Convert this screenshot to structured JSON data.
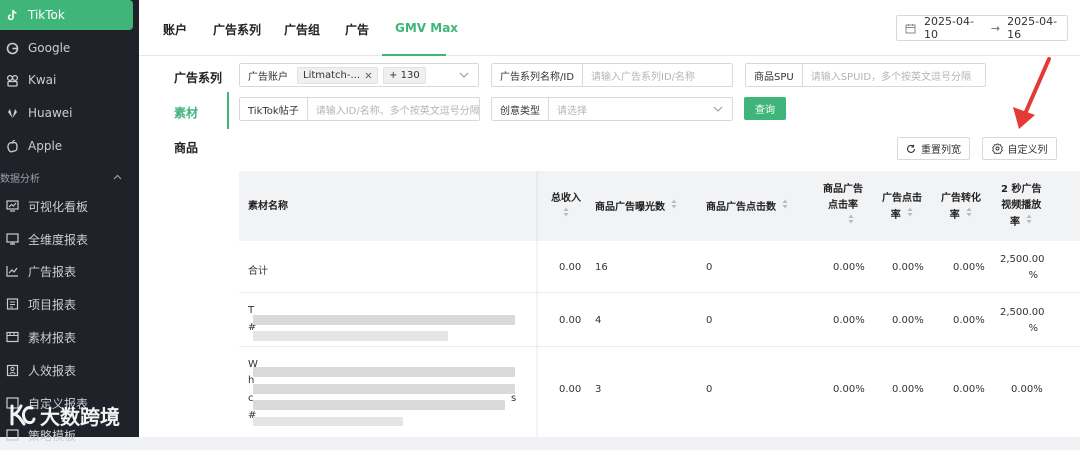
{
  "sidebar": {
    "items": [
      {
        "label": "TikTok",
        "icon": "tiktok-icon",
        "active": true
      },
      {
        "label": "Google",
        "icon": "google-icon"
      },
      {
        "label": "Kwai",
        "icon": "kwai-icon"
      },
      {
        "label": "Huawei",
        "icon": "huawei-icon"
      },
      {
        "label": "Apple",
        "icon": "apple-icon"
      }
    ],
    "section_label": "数据分析",
    "reports": [
      {
        "label": "可视化看板",
        "icon": "dashboard-icon"
      },
      {
        "label": "全维度报表",
        "icon": "monitor-icon"
      },
      {
        "label": "广告报表",
        "icon": "chart-icon"
      },
      {
        "label": "项目报表",
        "icon": "folder-icon"
      },
      {
        "label": "素材报表",
        "icon": "media-icon"
      },
      {
        "label": "人效报表",
        "icon": "person-icon"
      },
      {
        "label": "自定义报表",
        "icon": "custom-icon"
      },
      {
        "label": "策略模板",
        "icon": "template-icon"
      }
    ]
  },
  "watermark": "大数跨境",
  "tabs": [
    "账户",
    "广告系列",
    "广告组",
    "广告",
    "GMV Max"
  ],
  "active_tab": "GMV Max",
  "date_range": {
    "start": "2025-04-10",
    "separator": "→",
    "end": "2025-04-16"
  },
  "left_nav": [
    "广告系列",
    "素材",
    "商品"
  ],
  "filters": {
    "ad_account_label": "广告账户",
    "ad_account_tag": "Litmatch-...",
    "ad_account_more": "+ 130",
    "campaign_label": "广告系列名称/ID",
    "campaign_placeholder": "请输入广告系列ID/名称",
    "spu_label": "商品SPU",
    "spu_placeholder": "请输入SPUID，多个按英文逗号分隔",
    "tiktok_label": "TikTok帖子",
    "tiktok_placeholder": "请输入ID/名称、多个按英文逗号分隔",
    "creative_label": "创意类型",
    "creative_placeholder": "请选择",
    "query_button": "查询"
  },
  "toolbar": {
    "reset_columns": "重置列宽",
    "custom_columns": "自定义列"
  },
  "table": {
    "headers": {
      "name": "素材名称",
      "revenue": "总收入",
      "impressions": "商品广告曝光数",
      "clicks": "商品广告点击数",
      "ctr_line1": "商品广告",
      "ctr_line2": "点击率",
      "click_rate_line1": "广告点击",
      "click_rate_line2": "率",
      "conv_line1": "广告转化",
      "conv_line2": "率",
      "v2s_line1": "2 秒广告",
      "v2s_line2": "视频播放",
      "v2s_line3": "率"
    },
    "rows": [
      {
        "name": "合计",
        "revenue": "0.00",
        "impressions": "16",
        "clicks": "0",
        "ctr": "0.00%",
        "click_rate": "0.00%",
        "conv": "0.00%",
        "v2s_a": "2,500.00",
        "v2s_b": "%"
      },
      {
        "name_a": "T",
        "name_b": "#",
        "revenue": "0.00",
        "impressions": "4",
        "clicks": "0",
        "ctr": "0.00%",
        "click_rate": "0.00%",
        "conv": "0.00%",
        "v2s_a": "2,500.00",
        "v2s_b": "%"
      },
      {
        "name_a": "W",
        "name_b": "h",
        "name_c": "c",
        "name_d": "#",
        "name_e": "s",
        "revenue": "0.00",
        "impressions": "3",
        "clicks": "0",
        "ctr": "0.00%",
        "click_rate": "0.00%",
        "conv": "0.00%",
        "v2s": "0.00%"
      }
    ]
  },
  "colors": {
    "accent": "#3fb57a",
    "sidebar_bg": "#1f2329",
    "annotation_arrow": "#e53935"
  }
}
